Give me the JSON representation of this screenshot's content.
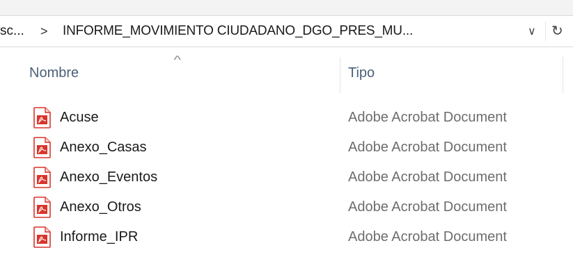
{
  "address_bar": {
    "ellipsis": "sc...",
    "separator": ">",
    "current_folder": "INFORME_MOVIMIENTO CIUDADANO_DGO_PRES_MU...",
    "dropdown_glyph": "∨",
    "refresh_glyph": "↻"
  },
  "columns": {
    "name": "Nombre",
    "type": "Tipo",
    "sort_indicator": "^"
  },
  "files": [
    {
      "name": "Acuse",
      "type": "Adobe Acrobat Document",
      "icon": "pdf-icon"
    },
    {
      "name": "Anexo_Casas",
      "type": "Adobe Acrobat Document",
      "icon": "pdf-icon"
    },
    {
      "name": "Anexo_Eventos",
      "type": "Adobe Acrobat Document",
      "icon": "pdf-icon"
    },
    {
      "name": "Anexo_Otros",
      "type": "Adobe Acrobat Document",
      "icon": "pdf-icon"
    },
    {
      "name": "Informe_IPR",
      "type": "Adobe Acrobat Document",
      "icon": "pdf-icon"
    }
  ],
  "colors": {
    "header_text": "#4c607a",
    "type_text": "#6d6d6d",
    "pdf_red": "#d9352b"
  }
}
